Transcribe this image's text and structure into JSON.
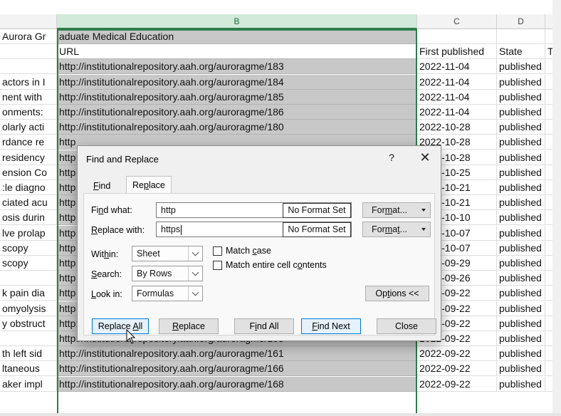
{
  "columns": [
    {
      "letter": "B",
      "selected": true
    },
    {
      "letter": "C",
      "selected": false
    },
    {
      "letter": "D",
      "selected": false
    }
  ],
  "rows": [
    {
      "a": "Aurora Gr",
      "b": "aduate Medical Education",
      "c": "",
      "d": "",
      "e": "",
      "b_white": false
    },
    {
      "a": "",
      "b": "URL",
      "c": "First published",
      "d": "State",
      "e": "To",
      "b_white": true
    },
    {
      "a": "",
      "b": "http://institutionalrepository.aah.org/auroragme/183",
      "c": "2022-11-04",
      "d": "published",
      "e": "",
      "b_white": false
    },
    {
      "a": "actors in I",
      "b": "http://institutionalrepository.aah.org/auroragme/184",
      "c": "2022-11-04",
      "d": "published",
      "e": "",
      "b_white": false
    },
    {
      "a": "nent with",
      "b": "http://institutionalrepository.aah.org/auroragme/185",
      "c": "2022-11-04",
      "d": "published",
      "e": "",
      "b_white": false
    },
    {
      "a": "onments:",
      "b": "http://institutionalrepository.aah.org/auroragme/186",
      "c": "2022-11-04",
      "d": "published",
      "e": "",
      "b_white": false
    },
    {
      "a": "olarly acti",
      "b": "http://institutionalrepository.aah.org/auroragme/180",
      "c": "2022-10-28",
      "d": "published",
      "e": "",
      "b_white": false
    },
    {
      "a": "rdance re",
      "b": "http",
      "c": "2022-10-28",
      "d": "published",
      "e": "",
      "b_white": false
    },
    {
      "a": "residency",
      "b": "http",
      "c": "2022-10-28",
      "d": "published",
      "e": "",
      "b_white": false
    },
    {
      "a": "ension Co",
      "b": "http",
      "c": "2022-10-25",
      "d": "published",
      "e": "",
      "b_white": false
    },
    {
      "a": ":le diagno",
      "b": "http",
      "c": "2022-10-21",
      "d": "published",
      "e": "",
      "b_white": false
    },
    {
      "a": "ciated acu",
      "b": "http",
      "c": "2022-10-21",
      "d": "published",
      "e": "",
      "b_white": false
    },
    {
      "a": "osis durin",
      "b": "http",
      "c": "2022-10-10",
      "d": "published",
      "e": "",
      "b_white": false
    },
    {
      "a": "lve prolap",
      "b": "http",
      "c": "2022-10-07",
      "d": "published",
      "e": "",
      "b_white": false
    },
    {
      "a": "scopy",
      "b": "http",
      "c": "2022-10-07",
      "d": "published",
      "e": "",
      "b_white": false
    },
    {
      "a": "scopy",
      "b": "http",
      "c": "2022-09-29",
      "d": "published",
      "e": "",
      "b_white": false
    },
    {
      "a": "",
      "b": "http",
      "c": "2022-09-26",
      "d": "published",
      "e": "",
      "b_white": false
    },
    {
      "a": "k pain dia",
      "b": "http",
      "c": "2022-09-22",
      "d": "published",
      "e": "",
      "b_white": false
    },
    {
      "a": "omyolysis",
      "b": "http",
      "c": "2022-09-22",
      "d": "published",
      "e": "",
      "b_white": false
    },
    {
      "a": "y obstruct",
      "b": "http://institutionalrepository.aah.org/auroragme/165",
      "c": "2022-09-22",
      "d": "published",
      "e": "",
      "b_white": false
    },
    {
      "a": "",
      "b": "http://institutionalrepository.aah.org/auroragme/163",
      "c": "2022-09-22",
      "d": "published",
      "e": "",
      "b_white": false
    },
    {
      "a": "th left sid",
      "b": "http://institutionalrepository.aah.org/auroragme/161",
      "c": "2022-09-22",
      "d": "published",
      "e": "",
      "b_white": false
    },
    {
      "a": "ltaneous",
      "b": "http://institutionalrepository.aah.org/auroragme/166",
      "c": "2022-09-22",
      "d": "published",
      "e": "",
      "b_white": false
    },
    {
      "a": "aker impl",
      "b": "http://institutionalrepository.aah.org/auroragme/168",
      "c": "2022-09-22",
      "d": "published",
      "e": "",
      "b_white": false
    }
  ],
  "dialog": {
    "title": "Find and Replace",
    "help": "?",
    "close": "✕",
    "tabs": [
      {
        "label": "Find",
        "active": false
      },
      {
        "label": "Replace",
        "active": true
      }
    ],
    "find_what_label": "Find what:",
    "find_what_value": "http",
    "replace_with_label": "Replace with:",
    "replace_with_value": "https",
    "no_format_label": "No Format Set",
    "format_label": "Format...",
    "within_label": "Within:",
    "within_value": "Sheet",
    "search_label": "Search:",
    "search_value": "By Rows",
    "look_in_label": "Look in:",
    "look_in_value": "Formulas",
    "match_case_label": "Match case",
    "match_case_checked": false,
    "match_entire_label": "Match entire cell contents",
    "match_entire_checked": false,
    "options_label": "Options <<",
    "buttons": {
      "replace_all": "Replace All",
      "replace": "Replace",
      "find_all": "Find All",
      "find_next": "Find Next",
      "close": "Close"
    }
  }
}
